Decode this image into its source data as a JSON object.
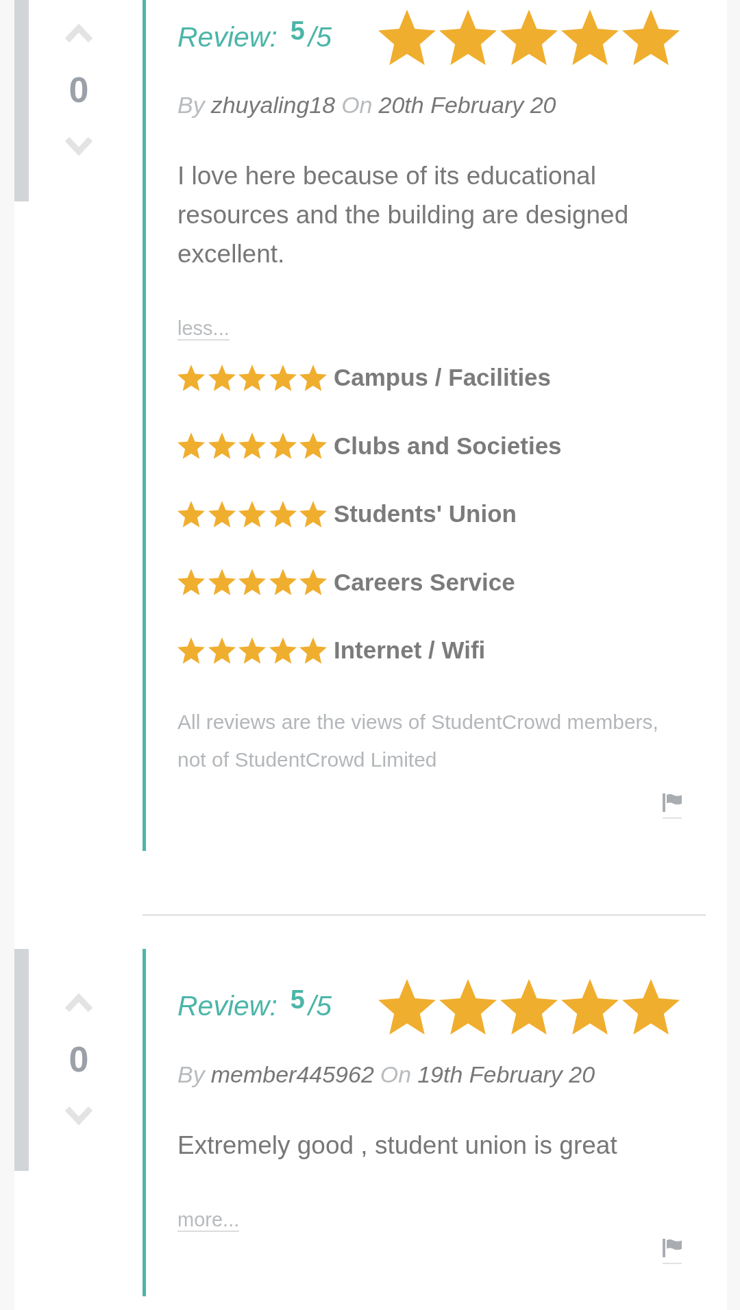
{
  "reviews": [
    {
      "votes": "0",
      "review_label": "Review:",
      "score": "5",
      "score_max": "/5",
      "stars": 5,
      "by_label": "By",
      "author": "zhuyaling18",
      "on_label": "On",
      "date": "20th February 20",
      "body": "I love here because of its educational resources and the building are designed excellent.",
      "toggle": "less...",
      "categories": [
        {
          "name": "Campus / Facilities",
          "stars": 5
        },
        {
          "name": "Clubs and Societies",
          "stars": 5
        },
        {
          "name": "Students' Union",
          "stars": 5
        },
        {
          "name": "Careers Service",
          "stars": 5
        },
        {
          "name": "Internet / Wifi",
          "stars": 5
        }
      ],
      "disclaimer": "All reviews are the views of StudentCrowd members, not of StudentCrowd Limited"
    },
    {
      "votes": "0",
      "review_label": "Review:",
      "score": "5",
      "score_max": "/5",
      "stars": 5,
      "by_label": "By",
      "author": "member445962",
      "on_label": "On",
      "date": "19th February 20",
      "body": "Extremely good , student union is great",
      "toggle": "more..."
    }
  ]
}
